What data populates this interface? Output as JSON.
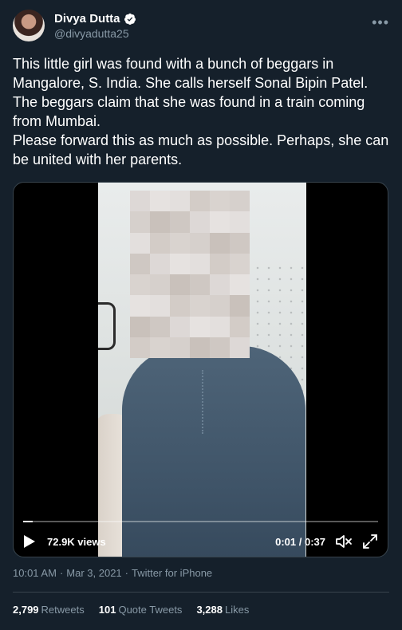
{
  "tweet": {
    "author": {
      "display_name": "Divya Dutta",
      "handle": "@divyadutta25",
      "verified": true
    },
    "more_icon": "more-icon",
    "text": "This little girl was found with a bunch of beggars in Mangalore, S. India. She calls herself Sonal Bipin Patel. The beggars claim that she was found in a train coming from Mumbai.\nPlease forward this as much as possible. Perhaps, she can be united with her parents.",
    "video": {
      "views": "72.9K views",
      "time": "0:01 / 0:37",
      "progress_fraction": 0.027,
      "icons": [
        "play-icon",
        "mute-icon",
        "fullscreen-icon"
      ]
    },
    "meta": {
      "time": "10:01 AM",
      "sep1": "·",
      "date": "Mar 3, 2021",
      "sep2": "·",
      "client": "Twitter for iPhone"
    },
    "stats": {
      "retweets_count": "2,799",
      "retweets_label": "Retweets",
      "quotes_count": "101",
      "quotes_label": "Quote Tweets",
      "likes_count": "3,288",
      "likes_label": "Likes"
    }
  },
  "colors": {
    "background": "#15202b",
    "secondary_text": "#8899a6",
    "border": "#38444d",
    "verified": "#ffffff"
  }
}
